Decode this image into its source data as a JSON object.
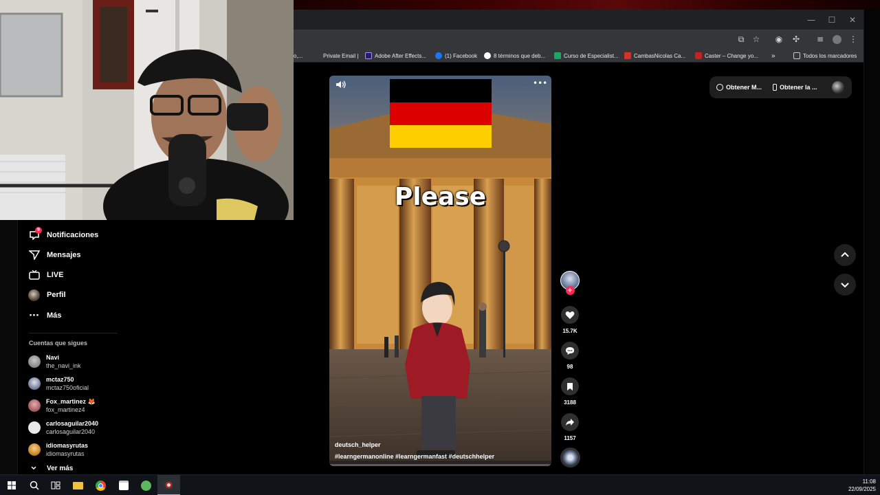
{
  "browser": {
    "bookmarks": [
      {
        "label": "o,...",
        "color": "#5f6368"
      },
      {
        "label": "Private Email |",
        "color": "#35363a"
      },
      {
        "label": "Adobe After Effects...",
        "color": "#2a1a6a"
      },
      {
        "label": "(1) Facebook",
        "color": "#1877f2"
      },
      {
        "label": "8 términos que deb...",
        "color": "#ffffff"
      },
      {
        "label": "Curso de Especialist...",
        "color": "#1fa463"
      },
      {
        "label": "CambasNicolas Ca...",
        "color": "#d93025"
      },
      {
        "label": "Caster – Change yo...",
        "color": "#c5221f"
      }
    ],
    "more_bookmarks": "»",
    "all_bookmarks": "Todos los marcadores"
  },
  "sidebar": {
    "nav": [
      {
        "label": "Notificaciones",
        "icon": "inbox-icon",
        "glyph": "✉",
        "badge": "9"
      },
      {
        "label": "Mensajes",
        "icon": "paper-plane-icon",
        "glyph": "➢"
      },
      {
        "label": "LIVE",
        "icon": "live-tv-icon",
        "glyph": "▣"
      },
      {
        "label": "Perfil",
        "icon": "avatar-icon",
        "glyph": ""
      },
      {
        "label": "Más",
        "icon": "more-dots-icon",
        "glyph": "···"
      }
    ],
    "following_title": "Cuentas que sigues",
    "following": [
      {
        "name": "Navi",
        "handle": "the_navi_ink",
        "color": "#7d7d7d"
      },
      {
        "name": "mctaz750",
        "handle": "mctaz750oficial",
        "color": "#3c4a6e"
      },
      {
        "name": "Fox_martinez 🦊",
        "handle": "fox_martinez4",
        "color": "#8a2c3c"
      },
      {
        "name": "carlosaguilar2040",
        "handle": "carlosaguilar2040",
        "color": "#e8e8e8"
      },
      {
        "name": "idiomasyrutas",
        "handle": "idiomasyrutas",
        "color": "#d08a2a"
      }
    ],
    "see_more": "Ver más"
  },
  "video": {
    "overlay_text": "Please",
    "username": "deutsch_helper",
    "hashtags": "#learngermanonline #learngermanfast #deutschhelper",
    "flag_colors": [
      "#000000",
      "#dd0000",
      "#ffce00"
    ]
  },
  "actions": {
    "likes": "15.7K",
    "comments": "98",
    "saves": "3188",
    "shares": "1157"
  },
  "top_right": {
    "get_app_1": "Obtener M...",
    "get_app_2": "Obtener la ..."
  },
  "taskbar": {
    "time": "11:08",
    "date": "22/09/2025"
  }
}
